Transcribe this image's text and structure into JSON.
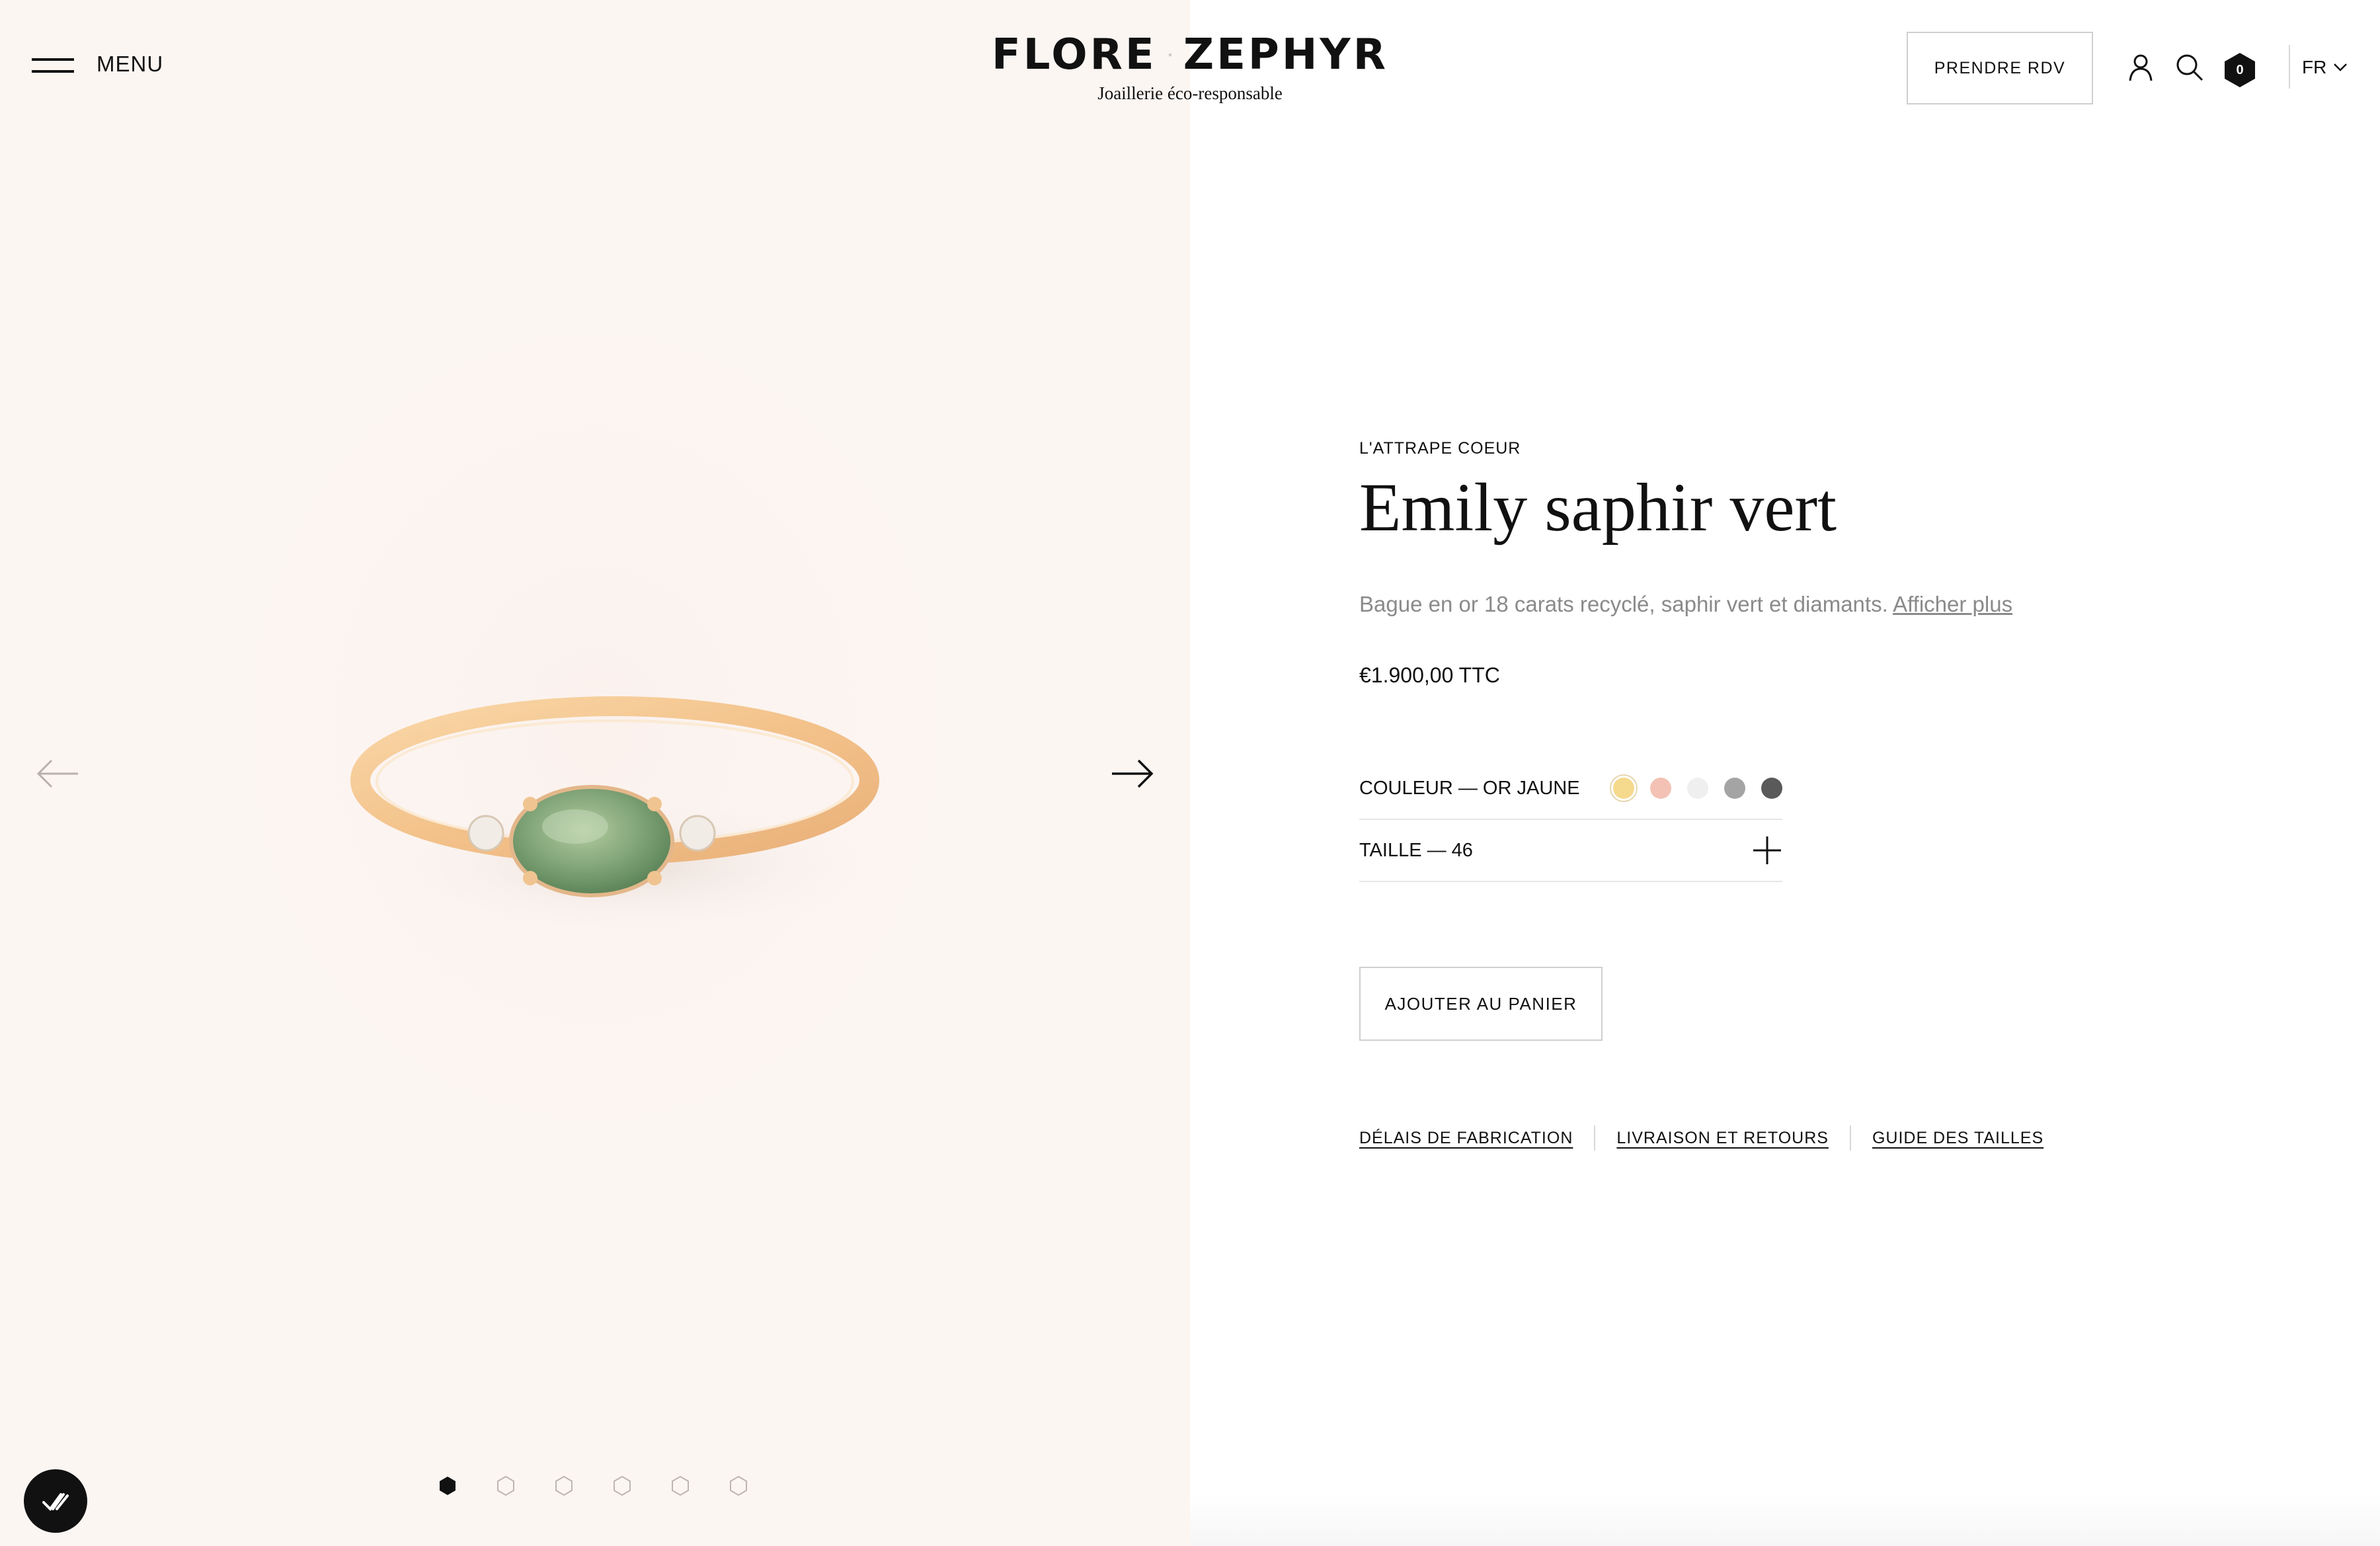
{
  "header": {
    "menu_label": "MENU",
    "logo_left": "FLORE",
    "logo_right": "ZEPHYR",
    "logo_amp": "&",
    "tagline": "Joaillerie éco-responsable",
    "rdv_label": "PRENDRE RDV",
    "cart_count": "0",
    "language": "FR"
  },
  "product": {
    "collection": "L'ATTRAPE COEUR",
    "title": "Emily saphir vert",
    "description": "Bague en or 18 carats recyclé, saphir vert et diamants.",
    "more_link": "Afficher plus",
    "price": "€1.900,00 TTC",
    "color_label": "COULEUR — OR JAUNE",
    "colors": [
      "#f5d98c",
      "#f3c2b4",
      "#efefef",
      "#a4a4a4",
      "#5a5a5a"
    ],
    "size_label": "TAILLE — 46",
    "add_to_cart": "AJOUTER AU PANIER",
    "links": [
      "DÉLAIS DE FABRICATION",
      "LIVRAISON ET RETOURS",
      "GUIDE DES TAILLES"
    ]
  },
  "gallery": {
    "slides": 6,
    "active_index": 0
  },
  "icons": {
    "menu": "hamburger-icon",
    "user": "user-icon",
    "search": "search-icon",
    "cart": "cart-hexagon-icon",
    "lang": "chevron-down-icon",
    "prev": "arrow-left-icon",
    "next": "arrow-right-icon",
    "size": "plus-icon",
    "badge": "checkmark-badge-icon"
  }
}
